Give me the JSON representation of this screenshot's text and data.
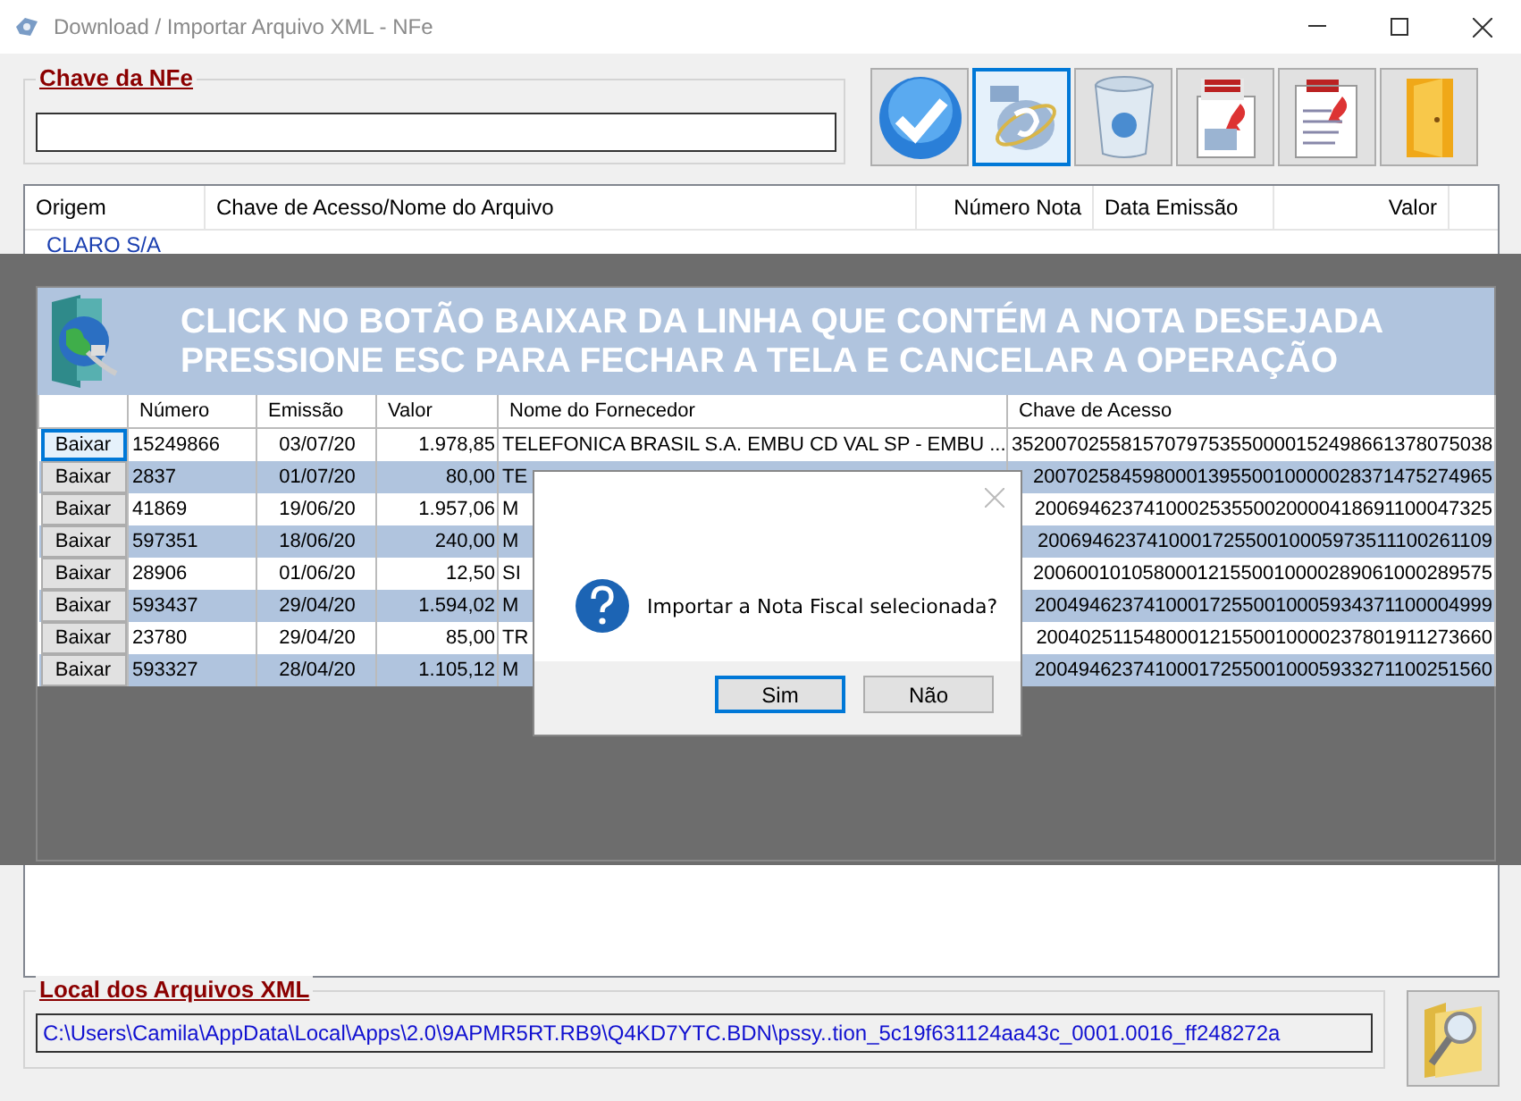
{
  "window": {
    "title": "Download / Importar Arquivo XML - NFe"
  },
  "chave_nfe": {
    "label": "Chave da NFe"
  },
  "toolbar": [
    {
      "kind": "confirm",
      "selected": false
    },
    {
      "kind": "nfe",
      "selected": true
    },
    {
      "kind": "trash",
      "selected": false
    },
    {
      "kind": "xml-import",
      "selected": false
    },
    {
      "kind": "xml-document",
      "selected": false
    },
    {
      "kind": "exit",
      "selected": false
    }
  ],
  "files_table": {
    "columns": [
      "Origem",
      "Chave de Acesso/Nome do Arquivo",
      "Número Nota",
      "Data Emissão",
      "Valor"
    ],
    "rows": [
      {
        "origem": "CLARO S/A"
      }
    ]
  },
  "download_panel": {
    "instructions": [
      "CLICK NO BOTÃO BAIXAR DA LINHA QUE CONTÉM A NOTA DESEJADA",
      "PRESSIONE ESC PARA FECHAR A TELA E CANCELAR A OPERAÇÃO"
    ],
    "columns": [
      "Número",
      "Emissão",
      "Valor",
      "Nome do Fornecedor",
      "Chave de Acesso"
    ],
    "rows": [
      {
        "button": "Baixar",
        "selected": true,
        "numero": "15249866",
        "emissao": "03/07/20",
        "valor": "1.978,85",
        "fornecedor": "TELEFONICA BRASIL S.A. EMBU CD VAL SP - EMBU ...",
        "chave": "35200702558157079753550000152498661378075038"
      },
      {
        "button": "Baixar",
        "selected": false,
        "numero": "2837",
        "emissao": "01/07/20",
        "valor": "80,00",
        "fornecedor": "TE",
        "chave": "200702584598000139550010000028371475274965"
      },
      {
        "button": "Baixar",
        "selected": false,
        "numero": "41869",
        "emissao": "19/06/20",
        "valor": "1.957,06",
        "fornecedor": "M",
        "chave": "200694623741000253550020000418691100047325"
      },
      {
        "button": "Baixar",
        "selected": false,
        "numero": "597351",
        "emissao": "18/06/20",
        "valor": "240,00",
        "fornecedor": "M",
        "chave": "200694623741000172550010005973511100261109"
      },
      {
        "button": "Baixar",
        "selected": false,
        "numero": "28906",
        "emissao": "01/06/20",
        "valor": "12,50",
        "fornecedor": "SI",
        "chave": "200600101058000121550010000289061000289575"
      },
      {
        "button": "Baixar",
        "selected": false,
        "numero": "593437",
        "emissao": "29/04/20",
        "valor": "1.594,02",
        "fornecedor": "M",
        "chave": "200494623741000172550010005934371100004999"
      },
      {
        "button": "Baixar",
        "selected": false,
        "numero": "23780",
        "emissao": "29/04/20",
        "valor": "85,00",
        "fornecedor": "TR",
        "chave": "200402511548000121550010000237801911273660"
      },
      {
        "button": "Baixar",
        "selected": false,
        "numero": "593327",
        "emissao": "28/04/20",
        "valor": "1.105,12",
        "fornecedor": "M",
        "chave": "200494623741000172550010005933271100251560"
      }
    ]
  },
  "dialog": {
    "message": "Importar a Nota Fiscal selecionada?",
    "buttons": [
      {
        "label": "Sim",
        "selected": true
      },
      {
        "label": "Não",
        "selected": false
      }
    ]
  },
  "xml_location": {
    "label": "Local dos Arquivos XML",
    "path": "C:\\Users\\Camila\\AppData\\Local\\Apps\\2.0\\9APMR5RT.RB9\\Q4KD7YTC.BDN\\pssy..tion_5c19f631124aa43c_0001.0016_ff248272a"
  }
}
